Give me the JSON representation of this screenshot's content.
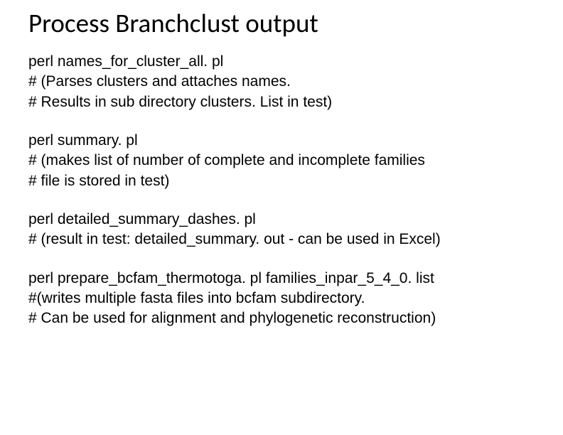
{
  "title": "Process Branchclust output",
  "blocks": [
    {
      "lines": [
        "perl names_for_cluster_all. pl",
        "#  (Parses clusters and attaches names.",
        "#  Results in sub directory clusters. List in test)"
      ]
    },
    {
      "lines": [
        "perl summary. pl",
        "# (makes list of number of complete and incomplete families",
        "# file is stored in test)"
      ]
    },
    {
      "lines": [
        "perl detailed_summary_dashes. pl",
        "# (result in test: detailed_summary. out - can be used in Excel)"
      ]
    },
    {
      "lines": [
        "perl prepare_bcfam_thermotoga. pl families_inpar_5_4_0. list",
        "#(writes multiple fasta files into bcfam subdirectory.",
        "# Can be used for alignment and phylogenetic reconstruction)"
      ]
    }
  ]
}
